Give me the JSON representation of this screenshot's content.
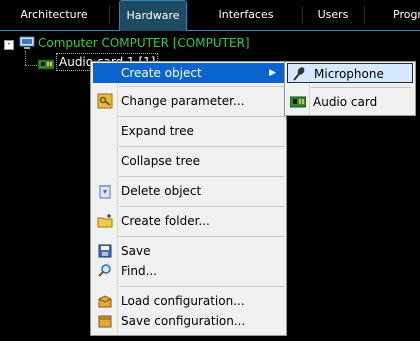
{
  "tabs": [
    {
      "label": "Architecture",
      "active": false
    },
    {
      "label": "Hardware",
      "active": true
    },
    {
      "label": "Interfaces",
      "active": false
    },
    {
      "label": "Users",
      "active": false
    },
    {
      "label": "Progr",
      "active": false
    }
  ],
  "tree": {
    "expander": "-",
    "root_label": "Computer COMPUTER [COMPUTER]",
    "child_label": "Audio card 1 [1]"
  },
  "context_menu": {
    "items": [
      {
        "label": "Create object",
        "icon": "none",
        "submenu": true,
        "highlighted": true
      },
      {
        "label": "Change parameter...",
        "icon": "key-icon"
      },
      {
        "label": "Expand tree",
        "icon": "none"
      },
      {
        "label": "Collapse tree",
        "icon": "none"
      },
      {
        "label": "Delete object",
        "icon": "recycle-bin-icon"
      },
      {
        "label": "Create folder...",
        "icon": "new-folder-icon"
      },
      {
        "label": "Save",
        "icon": "save-icon"
      },
      {
        "label": "Find...",
        "icon": "magnifier-icon"
      },
      {
        "label": "Load configuration...",
        "icon": "box-open-icon"
      },
      {
        "label": "Save configuration...",
        "icon": "box-save-icon"
      }
    ],
    "submenu_arrow": "▶"
  },
  "submenu": {
    "items": [
      {
        "label": "Microphone",
        "icon": "microphone-icon",
        "highlighted": true
      },
      {
        "label": "Audio card",
        "icon": "audio-card-icon"
      }
    ]
  },
  "colors": {
    "root_label": "#2ecc40",
    "menu_highlight": "#0a64d0",
    "active_tab": "#1e4a63"
  }
}
